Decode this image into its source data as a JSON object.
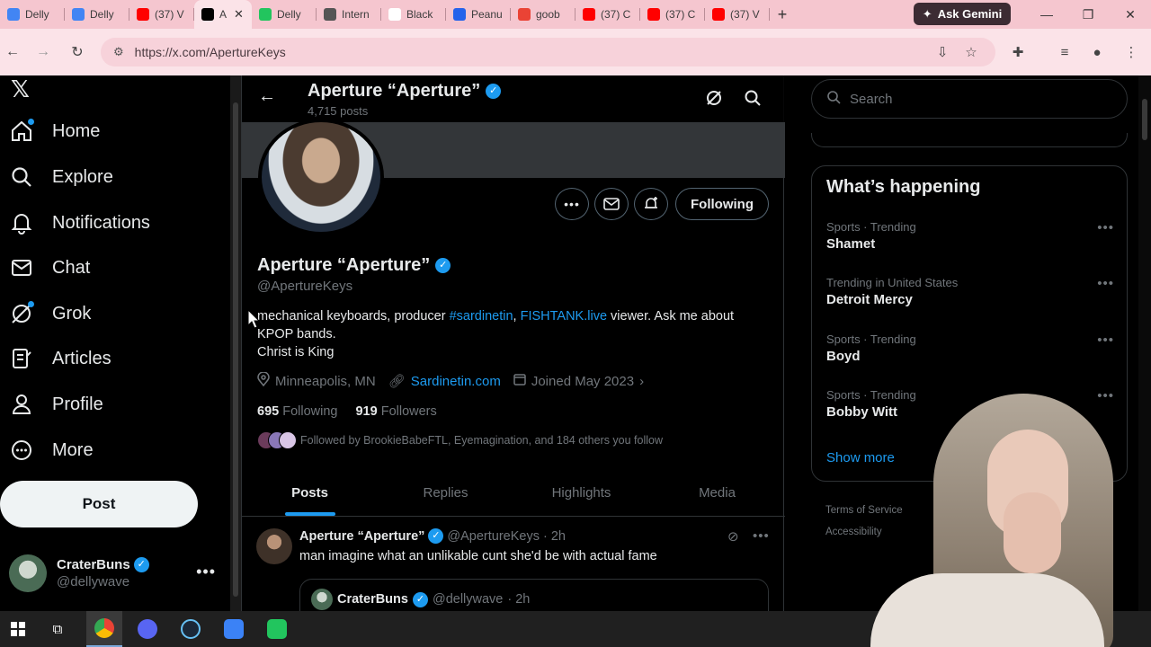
{
  "browser": {
    "tabs": [
      {
        "label": "Delly",
        "favicon_color": "#4285f4"
      },
      {
        "label": "Delly",
        "favicon_color": "#4285f4"
      },
      {
        "label": "(37) V",
        "favicon_color": "#ff0000"
      },
      {
        "label": "A",
        "favicon_color": "#000000",
        "active": true
      },
      {
        "label": "Delly",
        "favicon_color": "#22c55e"
      },
      {
        "label": "Intern",
        "favicon_color": "#555555"
      },
      {
        "label": "Black",
        "favicon_color": "#ffffff"
      },
      {
        "label": "Peanu",
        "favicon_color": "#2563eb"
      },
      {
        "label": "goob",
        "favicon_color": "#ea4335"
      },
      {
        "label": "(37) C",
        "favicon_color": "#ff0000"
      },
      {
        "label": "(37) C",
        "favicon_color": "#ff0000"
      },
      {
        "label": "(37) V",
        "favicon_color": "#ff0000"
      }
    ],
    "gemini_label": "Ask Gemini",
    "url": "https://x.com/ApertureKeys"
  },
  "sidebar": {
    "items": [
      {
        "label": "Home",
        "icon": "home-icon"
      },
      {
        "label": "Explore",
        "icon": "search-icon"
      },
      {
        "label": "Notifications",
        "icon": "bell-icon"
      },
      {
        "label": "Chat",
        "icon": "mail-icon"
      },
      {
        "label": "Grok",
        "icon": "grok-icon"
      },
      {
        "label": "Articles",
        "icon": "articles-icon"
      },
      {
        "label": "Profile",
        "icon": "person-icon"
      },
      {
        "label": "More",
        "icon": "more-icon"
      }
    ],
    "post_label": "Post",
    "account": {
      "name": "CraterBuns",
      "handle": "@dellywave"
    }
  },
  "header": {
    "name": "Aperture “Aperture”",
    "post_count": "4,715 posts"
  },
  "profile": {
    "name": "Aperture “Aperture”",
    "handle": "@ApertureKeys",
    "following_button": "Following",
    "bio_part1": "mechanical keyboards, producer ",
    "bio_link1": "#sardinetin",
    "bio_comma": ", ",
    "bio_link2": "FISHTANK.live",
    "bio_part2": " viewer. Ask me about KPOP bands.",
    "bio_line2": "Christ is King",
    "location": "Minneapolis, MN",
    "website": "Sardinetin.com",
    "joined": "Joined May 2023",
    "following_count": "695",
    "following_label": "Following",
    "followers_count": "919",
    "followers_label": "Followers",
    "followed_by": "Followed by BrookieBabeFTL, Eyemagination, and 184 others you follow"
  },
  "tabs": [
    "Posts",
    "Replies",
    "Highlights",
    "Media"
  ],
  "tweet": {
    "name": "Aperture “Aperture”",
    "handle": "@ApertureKeys",
    "time": "· 2h",
    "text": "man imagine what an unlikable cunt she'd be with actual fame",
    "quote": {
      "name": "CraterBuns",
      "handle": "@dellywave",
      "time": "· 2h"
    }
  },
  "right": {
    "search_placeholder": "Search",
    "happening_title": "What’s happening",
    "trends": [
      {
        "context": "Sports · Trending",
        "topic": "Shamet"
      },
      {
        "context": "Trending in United States",
        "topic": "Detroit Mercy"
      },
      {
        "context": "Sports · Trending",
        "topic": "Boyd"
      },
      {
        "context": "Sports · Trending",
        "topic": "Bobby Witt"
      }
    ],
    "show_more": "Show more",
    "footer1": "Terms of Service",
    "footer2": "Accessibility"
  },
  "colors": {
    "accent": "#1d9bf0",
    "background": "#000000",
    "tab_strip": "#f5c6cf"
  }
}
